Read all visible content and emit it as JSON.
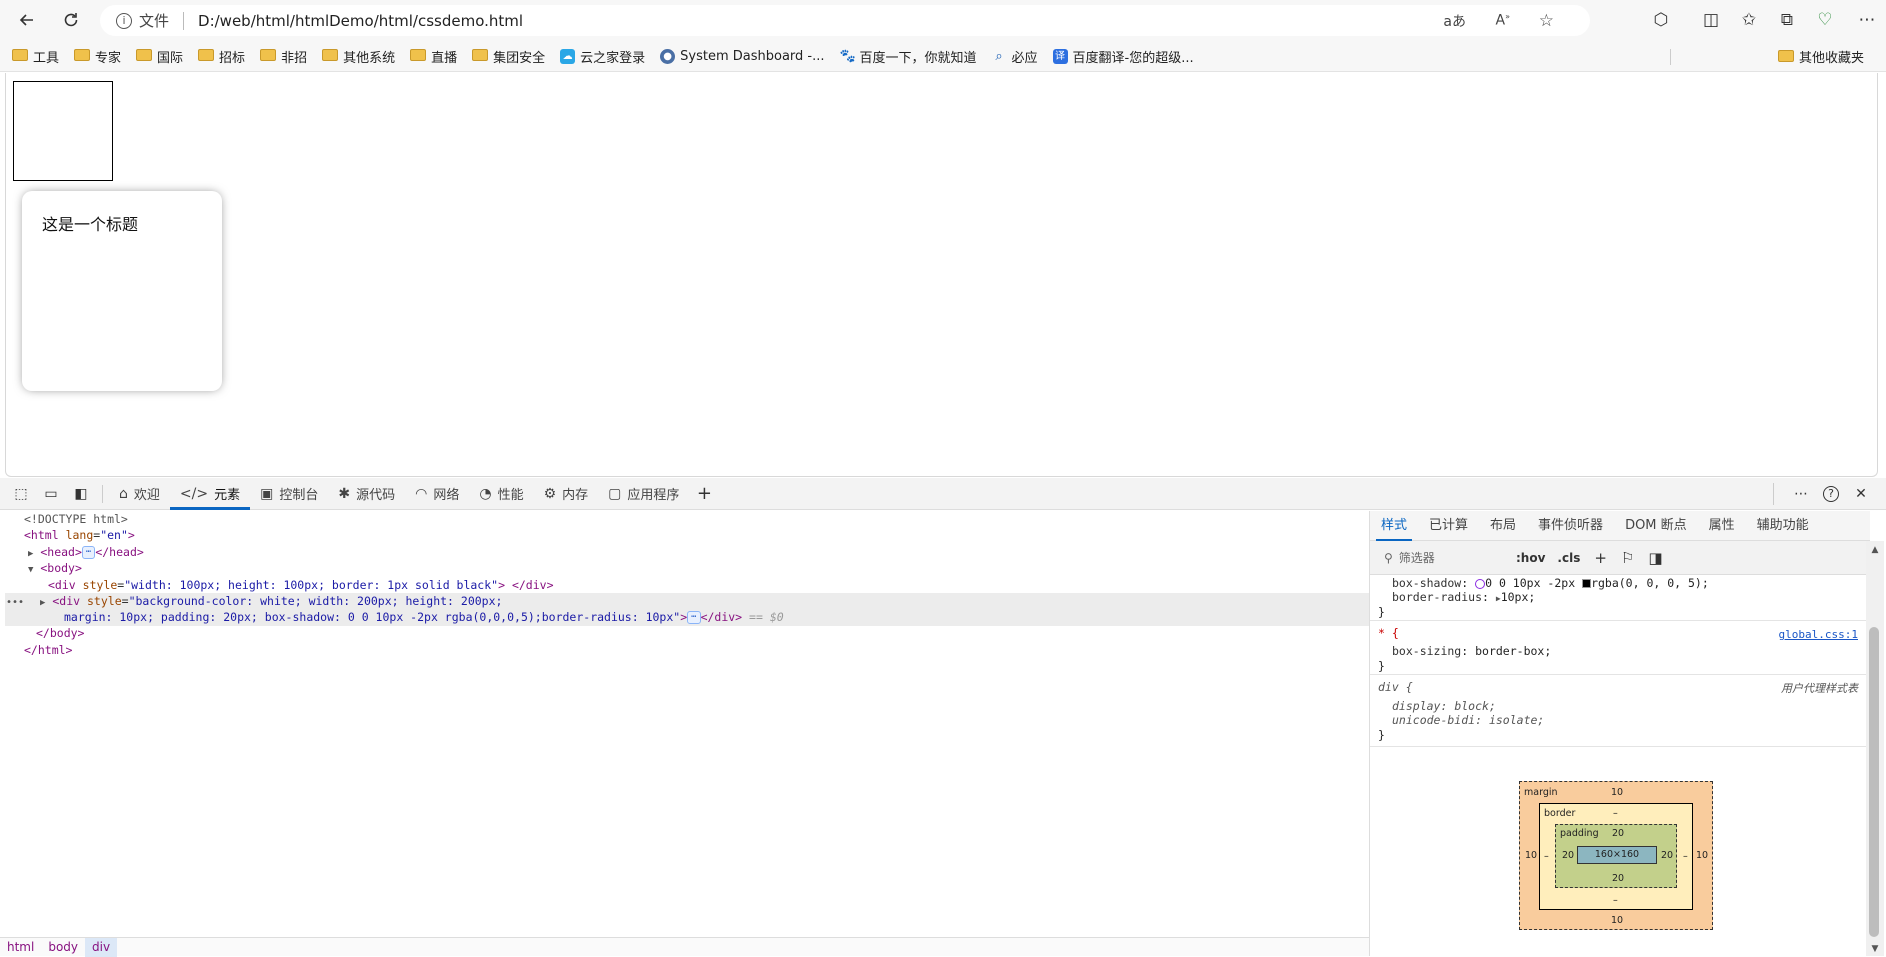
{
  "browser": {
    "address_prefix": "文件",
    "url": "D:/web/html/htmlDemo/html/cssdemo.html",
    "bookmarks": [
      "工具",
      "专家",
      "国际",
      "招标",
      "非招",
      "其他系统",
      "直播",
      "集团安全",
      "云之家登录",
      "System Dashboard -...",
      "百度一下，你就知道",
      "必应",
      "百度翻译-您的超级..."
    ],
    "other_bookmarks": "其他收藏夹"
  },
  "page": {
    "card_title": "这是一个标题"
  },
  "devtools": {
    "tabs": [
      {
        "label": "欢迎",
        "icon": "home-icon"
      },
      {
        "label": "元素",
        "icon": "code-icon"
      },
      {
        "label": "控制台",
        "icon": "console-icon"
      },
      {
        "label": "源代码",
        "icon": "bug-icon"
      },
      {
        "label": "网络",
        "icon": "wifi-icon"
      },
      {
        "label": "性能",
        "icon": "speedometer-icon"
      },
      {
        "label": "内存",
        "icon": "chip-icon"
      },
      {
        "label": "应用程序",
        "icon": "window-icon"
      }
    ],
    "dom": {
      "doctype": "<!DOCTYPE html>",
      "html_open": "<html",
      "lang_attr": "lang",
      "lang_val": "\"en\"",
      "head_open": "<head>",
      "head_close": "</head>",
      "body_open": "<body>",
      "div1_open": "<div",
      "style_attr": "style",
      "div1_style": "\"width: 100px; height: 100px; border: 1px solid black\"",
      "div_gt": ">",
      "div_close": "</div>",
      "div2_style_l1": "\"background-color: white; width: 200px; height: 200px;",
      "div2_style_l2": "margin: 10px; padding: 20px; box-shadow: 0 0 10px -2px rgba(0,0,0,5);border-radius: 10px\"",
      "selected_marker": "== $0",
      "body_close": "</body>",
      "html_close": "</html>",
      "ellipsis": "⋯",
      "row_dots": "•••"
    },
    "breadcrumbs": [
      "html",
      "body",
      "div"
    ],
    "side_tabs": [
      "样式",
      "已计算",
      "布局",
      "事件侦听器",
      "DOM 断点",
      "属性",
      "辅助功能"
    ],
    "filter_placeholder": "筛选器",
    "hov": ":hov",
    "cls": ".cls",
    "styles": {
      "r1_prop1": "box-shadow",
      "r1_val1a": "0 0 10px -2px",
      "r1_val1b": "rgba(0, 0, 0, 5);",
      "r1_prop2": "border-radius",
      "r1_val2": "10px;",
      "r2_selector": "* {",
      "r2_source": "global.css:1",
      "r2_prop": "box-sizing",
      "r2_val": "border-box;",
      "r3_selector": "div {",
      "r3_source": "用户代理样式表",
      "r3_prop1": "display",
      "r3_val1": "block;",
      "r3_prop2": "unicode-bidi",
      "r3_val2": "isolate;",
      "close_brace": "}"
    },
    "box_model": {
      "margin_label": "margin",
      "margin_top": "10",
      "margin_bottom": "10",
      "margin_left": "10",
      "margin_right": "10",
      "border_label": "border",
      "border_top": "–",
      "border_bottom": "–",
      "border_left": "–",
      "border_right": "–",
      "padding_label": "padding",
      "padding_top": "20",
      "padding_bottom": "20",
      "padding_left": "20",
      "padding_right": "20",
      "content": "160×160"
    }
  }
}
